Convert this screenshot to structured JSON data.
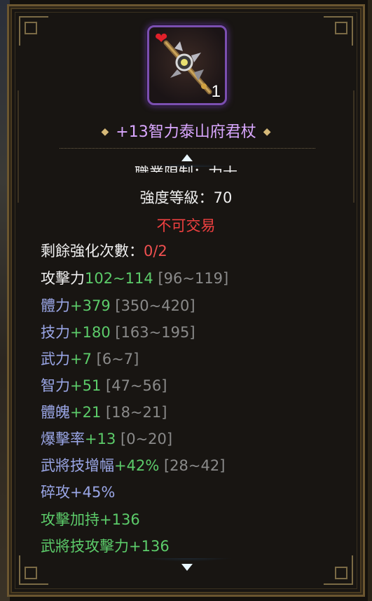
{
  "item": {
    "stack_count": "1",
    "name": "+13智力泰山府君杖",
    "icon": "staff-weapon-icon",
    "favorite_icon": "heart-icon"
  },
  "header_lines": {
    "cut_text": "職業限制：力士",
    "strength_label": "強度等級：70",
    "untradeable": "不可交易"
  },
  "enhance": {
    "label": "剩餘強化次數：",
    "value": "0/2"
  },
  "attack": {
    "label": "攻擊力",
    "value": "102~114",
    "range": "[96~119]"
  },
  "stats": [
    {
      "label": "體力",
      "value": "+379",
      "range": "[350~420]"
    },
    {
      "label": "技力",
      "value": "+180",
      "range": "[163~195]"
    },
    {
      "label": "武力",
      "value": "+7",
      "range": "[6~7]"
    },
    {
      "label": "智力",
      "value": "+51",
      "range": "[47~56]"
    },
    {
      "label": "體魄",
      "value": "+21",
      "range": "[18~21]"
    },
    {
      "label": "爆擊率",
      "value": "+13",
      "range": "[0~20]"
    },
    {
      "label": "武將技增幅",
      "value": "+42%",
      "range": "[28~42]"
    }
  ],
  "extra_lines": {
    "crush": "碎攻+45%",
    "attack_bonus": "攻擊加持+136",
    "general_skill_attack": "武將技攻擊力+136"
  },
  "colors": {
    "name_purple": "#d9a7ff",
    "value_green": "#5ccc6a",
    "stat_blue": "#9aa6e6",
    "range_gray": "#8a8a8a",
    "warning_red": "#f04040",
    "frame_gold": "#6b5630",
    "icon_border": "#7b4fb0"
  }
}
